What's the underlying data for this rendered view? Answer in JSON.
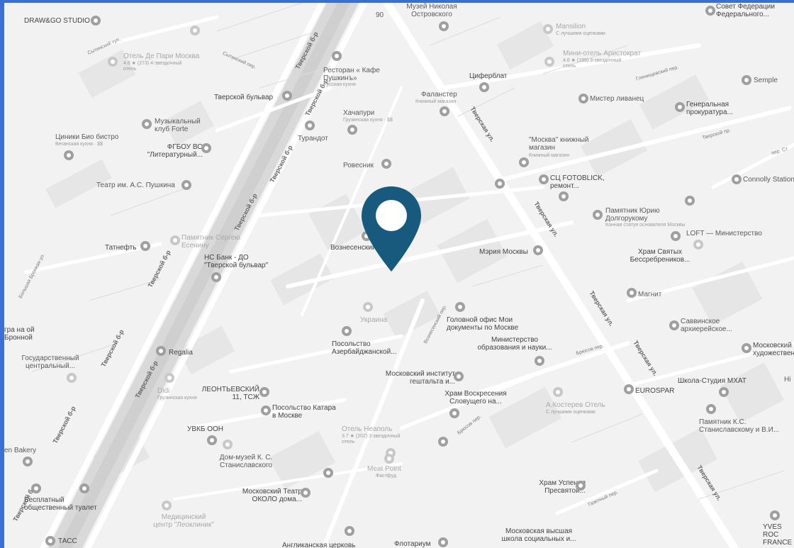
{
  "map": {
    "background": "#f2f2f2",
    "road_color": "#ffffff",
    "block_color": "#e6e6e6",
    "marker_color": "#185a7d",
    "marker_icon": "map-pin-icon"
  },
  "streets": {
    "tverskoy_b_r": "Тверской б-р",
    "tverskaya_ul": "Тверская ул.",
    "sytinsky": "Сытинский пер.",
    "sytinsky2": "Сытинский туп.",
    "glinishchevsky": "Глинищевский пер.",
    "tverskoy_pr": "Тверской пр.",
    "voznesensky": "Вознесенский пер.",
    "bryusov": "Брюсов пер.",
    "bryusov2": "Брюсов пер.",
    "gazetny": "Газетный пер.",
    "bolshaya_bronnaya": "Большая Бронная ул.",
    "pr_st": "пер. Ст"
  },
  "places": {
    "drawgo": "DRAW&GO STUDIO",
    "muzey_nikolaya": "Музей Николая Островского",
    "sovet_fed": "Совет Федерации Федерального...",
    "mansilion": "Mansilion",
    "mansilion_sub": "С лучшими оценками",
    "hotel_de_pari": "Отель Де Пари Москва",
    "hotel_de_pari_sub": "4.6 ★ (273) 4-звездочный отель",
    "restoran_pushkin": "Ресторан « Кафе Пушкинъ»",
    "restoran_pushkin_sub": "Русская кухня",
    "mini_hotel": "Мини-отель Аристократ",
    "mini_hotel_sub": "4.6 ★ (199) 3-звездочный отель",
    "tsiferblat": "Циферблат",
    "semple": "Semple",
    "tverskoy_bulvar": "Тверской бульвар",
    "falanster": "Фаланстер",
    "falanster_sub": "Книжный магазин",
    "mister_livanets": "Мистер ливанец",
    "gen_prokuratura": "Генеральная прокуратура...",
    "muz_klub": "Музыкальный клуб Forte",
    "khachapuri": "Хачапури",
    "khachapuri_sub": "Грузинская кухня · $$",
    "tsiniki": "Циники Био бистро",
    "tsiniki_sub": "Веганская кухня · $$",
    "turandot": "Турандот",
    "fgbou": "ФГБОУ ВО \"Литературный...",
    "moskva_knizhny": "\"Москва\" книжный магазин",
    "moskva_knizhny_sub": "Книжный магазин",
    "rovesnik": "Ровесник",
    "sc_fotoblick": "СЦ FOTOBLICK, ремонт...",
    "connolly": "Connolly Station",
    "teatr_pushkina": "Театр им. А.С. Пушкина",
    "pamyatnik_yuri": "Памятник Юрию Долгорукому",
    "pamyatnik_yuri_sub": "Конная статуя основателя Москвы",
    "loft": "LOFT — Министерство",
    "pamyatnik_esenin": "Памятник Сергею Есенину",
    "voznesensky_place": "Вознесенский",
    "meriya": "Мэрия Москвы",
    "khram_svyatykh": "Храм Святых Бессребреников...",
    "tatneft": "Татнефть",
    "ns_bank": "НС Банк - ДО \"Тверской бульвар\"",
    "magnit": "Магнит",
    "ukraina": "Украина",
    "golovnoy_ofis": "Головной офис Мои документы по Москве",
    "savvinskoe": "Саввинское архиерейское...",
    "teatr_na_bronnoy": "гра на ой Бронной",
    "posolstvo_az": "Посольство Азербайджанской...",
    "ministerstvo_obr": "Министерство образования и науки...",
    "moskovsky_khud": "Московский художествен...",
    "gos_tsentralny": "Государственный центральный...",
    "regalia": "Regalia",
    "moskovsky_institut": "Московский институт гештальта и...",
    "shkola_mkhat": "Школа-Студия МХАТ",
    "didi": "Didi",
    "didi_sub": "Грузинская кухня",
    "leontievsky": "ЛЕОНТЬЕВСКИЙ 11, ТСЖ",
    "khram_voskreseniya": "Храм Воскресения Словущего на...",
    "eurospar": "EUROSPAR",
    "kostereva": "А.Костерев Отель",
    "kostereva_sub": "С лучшими оценками",
    "posolstvo_katara": "Посольство Катара в Москве",
    "pamyatnik_ks": "Памятник К.С. Станиславскому и В.И...",
    "en_bakery": "en Bakery",
    "uvkb": "УВКБ ООН",
    "otel_neapol": "Отель Неаполь",
    "otel_neapol_sub": "3.7 ★ (202) 3-звездочный отель",
    "dom_muzey": "Дом-музей К. С. Станиславского",
    "meat_point": "Meat Point",
    "meat_point_sub": "Фастфуд",
    "khram_uspeniya": "Храм Успения Пресвятой...",
    "besplatny_tualet": "Бесплатный общественный туалет",
    "moskovsky_teatr": "Московский Театр ОКОЛО дома...",
    "meditsinsky": "Медицинский центр \"Леоклиник\"",
    "tass": "ТАСС",
    "anglikanskaya": "Англиканская церковь",
    "flotarium": "Флотариум",
    "moskovskaya_vysshaya": "Московская высшая школа социальных и...",
    "yves_rocher": "YVES ROC FRANCE",
    "hl": "Hi",
    "num_90": "90"
  }
}
